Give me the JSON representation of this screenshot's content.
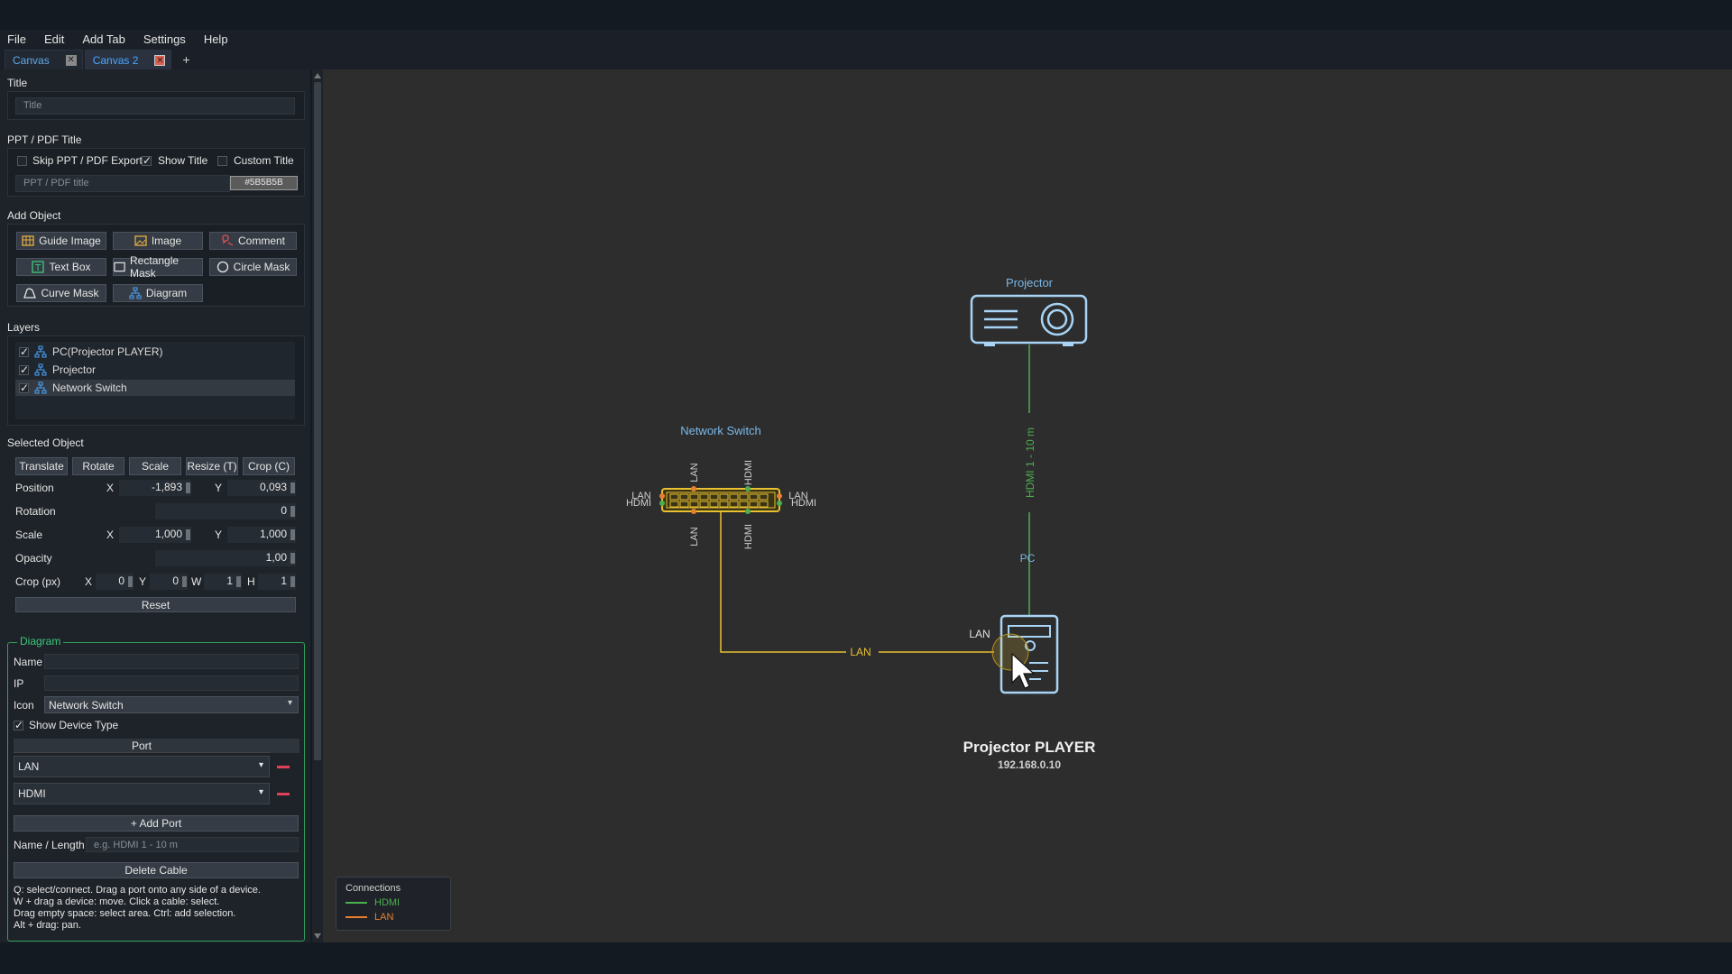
{
  "menu": [
    "File",
    "Edit",
    "Add Tab",
    "Settings",
    "Help"
  ],
  "tabs": [
    {
      "label": "Canvas",
      "active": false
    },
    {
      "label": "Canvas 2",
      "active": true
    }
  ],
  "tab_add": "+",
  "panel": {
    "title_section": "Title",
    "title_placeholder": "Title",
    "ppt_section": "PPT / PDF Title",
    "skip_ppt": "Skip PPT / PDF Export",
    "show_title": "Show Title",
    "custom_title": "Custom Title",
    "ppt_placeholder": "PPT / PDF title",
    "color_value": "#5B5B5B",
    "add_object_section": "Add Object",
    "add_buttons": {
      "guide_image": "Guide Image",
      "image": "Image",
      "comment": "Comment",
      "text_box": "Text Box",
      "rectangle_mask": "Rectangle Mask",
      "circle_mask": "Circle Mask",
      "curve_mask": "Curve Mask",
      "diagram": "Diagram"
    },
    "layers_section": "Layers",
    "layers": [
      "PC(Projector PLAYER)",
      "Projector",
      "Network Switch"
    ],
    "selected_section": "Selected Object",
    "transform_buttons": {
      "translate": "Translate",
      "rotate": "Rotate",
      "scale": "Scale",
      "resize": "Resize (T)",
      "crop": "Crop (C)"
    },
    "position_label": "Position",
    "position_x": "-1,893",
    "position_y": "0,093",
    "rotation_label": "Rotation",
    "rotation_value": "0",
    "scale_label": "Scale",
    "scale_x": "1,000",
    "scale_y": "1,000",
    "opacity_label": "Opacity",
    "opacity_value": "1,00",
    "crop_label": "Crop (px)",
    "crop_x": "0",
    "crop_y": "0",
    "crop_w": "1",
    "crop_h": "1",
    "axis_x": "X",
    "axis_y": "Y",
    "axis_w": "W",
    "axis_h": "H",
    "reset": "Reset",
    "diagram_section": "Diagram",
    "name_label": "Name",
    "ip_label": "IP",
    "icon_label": "Icon",
    "icon_value": "Network Switch",
    "show_device_type": "Show Device Type",
    "port_header": "Port",
    "ports": [
      "LAN",
      "HDMI"
    ],
    "add_port": "+ Add Port",
    "name_length_label": "Name / Length",
    "name_length_placeholder": "e.g. HDMI 1 - 10 m",
    "delete_cable": "Delete Cable",
    "help_lines": [
      "Q: select/connect. Drag a port onto any side of a device.",
      "W + drag a device: move. Click a cable: select.",
      "Drag empty space: select area. Ctrl: add selection.",
      "Alt + drag: pan."
    ]
  },
  "canvas": {
    "projector_label": "Projector",
    "switch_label": "Network Switch",
    "cable_hdmi_label": "HDMI 1 - 10 m",
    "pc_label": "PC",
    "cable_lan_label": "LAN",
    "pc_port_label": "LAN",
    "port_labels": {
      "lan": "LAN",
      "hdmi": "HDMI"
    },
    "device_name": "Projector PLAYER",
    "device_ip": "192.168.0.10",
    "legend_title": "Connections",
    "legend_hdmi": "HDMI",
    "legend_lan": "LAN",
    "colors": {
      "hdmi": "#4caf50",
      "lan": "#e8c030",
      "device": "#a8d4f5",
      "label_blue": "#7ab8e8"
    }
  }
}
